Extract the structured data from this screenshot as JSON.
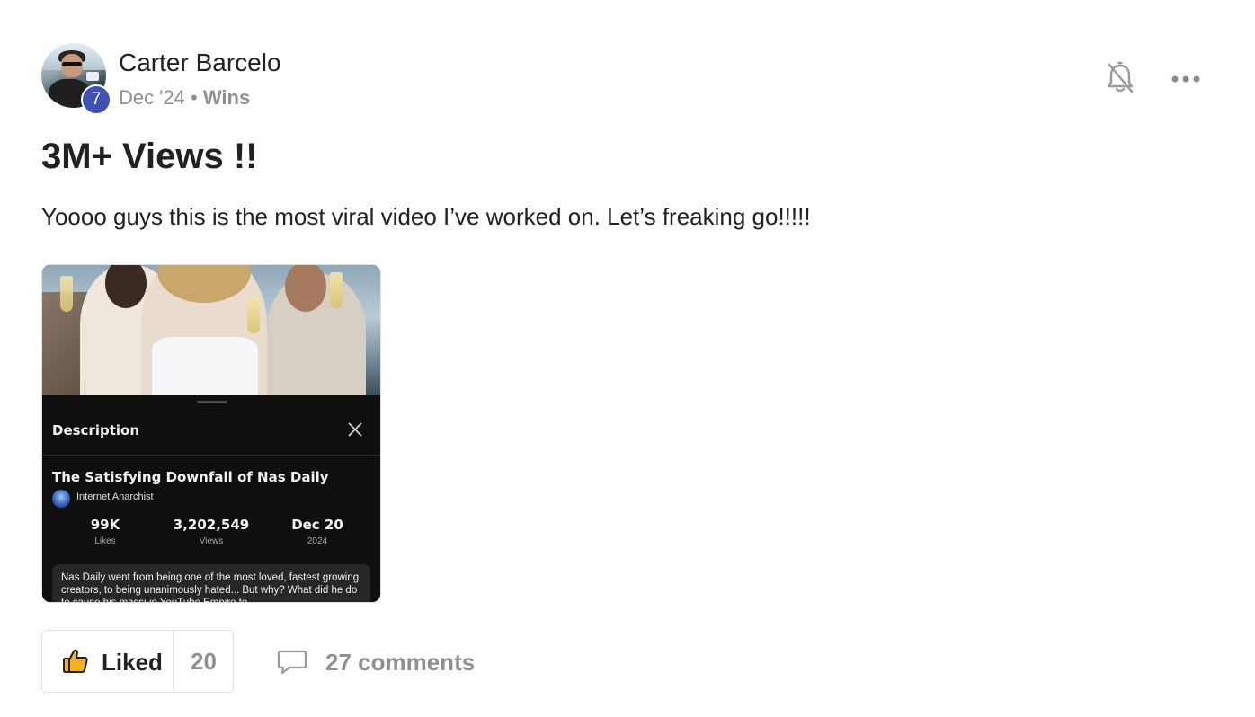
{
  "post": {
    "author": "Carter Barcelo",
    "level": "7",
    "date": "Dec '24",
    "separator": "•",
    "category": "Wins",
    "title": "3M+ Views !!",
    "body": "Yoooo guys this is the most viral video I’ve worked on. Let’s freaking go!!!!!"
  },
  "attachment": {
    "panel_title": "Description",
    "video_title": "The Satisfying Downfall of Nas Daily",
    "channel": "Internet Anarchist",
    "stats": [
      {
        "value": "99K",
        "label": "Likes"
      },
      {
        "value": "3,202,549",
        "label": "Views"
      },
      {
        "value": "Dec 20",
        "label": "2024"
      }
    ],
    "description": "Nas Daily went from being one of the most loved, fastest growing creators, to being unanimously hated... But why? What did he do to cause his massive YouTube Empire to"
  },
  "actions": {
    "like_label": "Liked",
    "like_count": "20",
    "comments_label": "27 comments"
  },
  "icons": {
    "bell": "bell-off-icon",
    "more": "more-horizontal-icon",
    "like": "thumbs-up-icon",
    "comment": "comment-bubble-icon",
    "close": "close-icon"
  },
  "colors": {
    "level_badge": "#3f51b5",
    "muted_text": "#909090",
    "like_icon": "#f5b21f"
  }
}
